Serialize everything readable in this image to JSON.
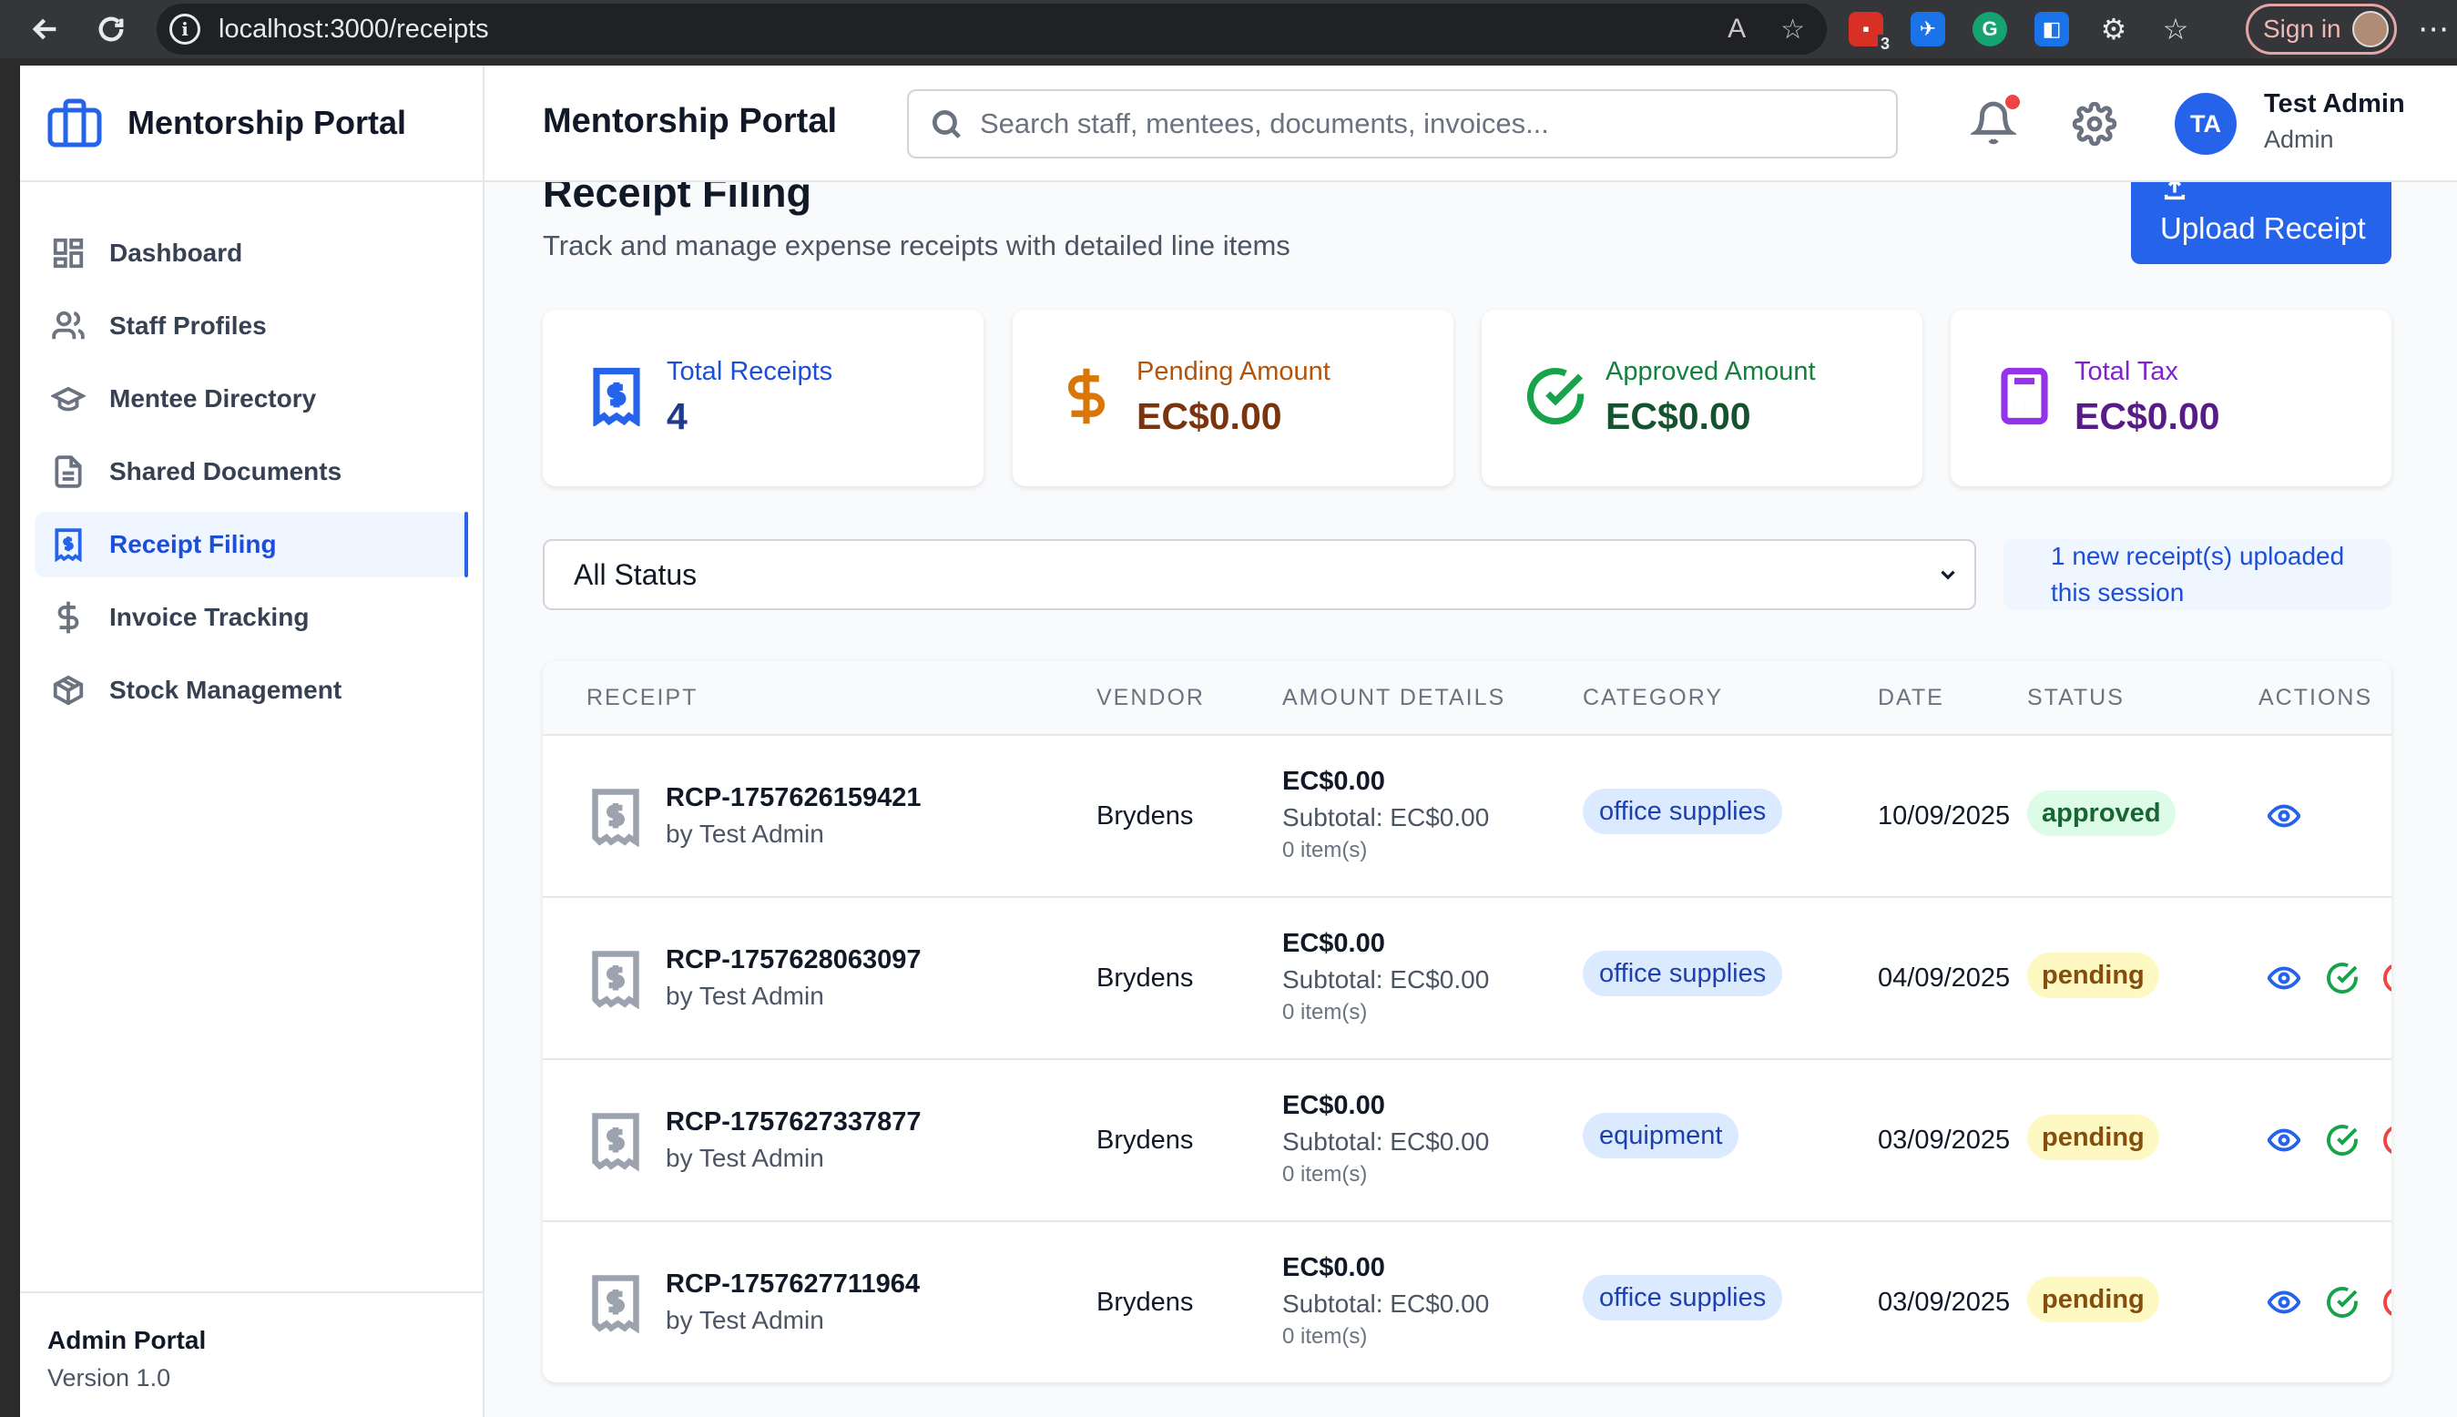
{
  "browser": {
    "url": "localhost:3000/receipts",
    "sign_in_label": "Sign in",
    "ext_badge_count": "3"
  },
  "sidebar": {
    "brand": "Mentorship Portal",
    "items": [
      {
        "label": "Dashboard",
        "icon": "grid-icon"
      },
      {
        "label": "Staff Profiles",
        "icon": "users-icon"
      },
      {
        "label": "Mentee Directory",
        "icon": "graduation-cap-icon"
      },
      {
        "label": "Shared Documents",
        "icon": "document-icon"
      },
      {
        "label": "Receipt Filing",
        "icon": "receipt-icon",
        "active": true
      },
      {
        "label": "Invoice Tracking",
        "icon": "dollar-icon"
      },
      {
        "label": "Stock Management",
        "icon": "package-icon"
      }
    ],
    "footer_title": "Admin Portal",
    "footer_version": "Version 1.0"
  },
  "header": {
    "title": "Mentorship Portal",
    "search_placeholder": "Search staff, mentees, documents, invoices...",
    "user_initials": "TA",
    "user_name": "Test Admin",
    "user_role": "Admin"
  },
  "page": {
    "title": "Receipt Filing",
    "subtitle": "Track and manage expense receipts with detailed line items",
    "upload_label": "Upload Receipt"
  },
  "stats": [
    {
      "label": "Total Receipts",
      "value": "4",
      "icon": "receipt-icon",
      "label_color": "#1d4ed8",
      "value_color": "#1e3a8a"
    },
    {
      "label": "Pending Amount",
      "value": "EC$0.00",
      "icon": "dollar-icon",
      "label_color": "#b45309",
      "value_color": "#78350f"
    },
    {
      "label": "Approved Amount",
      "value": "EC$0.00",
      "icon": "check-circle-icon",
      "label_color": "#15803d",
      "value_color": "#14532d"
    },
    {
      "label": "Total Tax",
      "value": "EC$0.00",
      "icon": "calculator-icon",
      "label_color": "#7e22ce",
      "value_color": "#581c87"
    }
  ],
  "filter": {
    "selected": "All Status",
    "note_line1": "1 new receipt(s) uploaded",
    "note_line2": "this session"
  },
  "table": {
    "columns": [
      "RECEIPT",
      "VENDOR",
      "AMOUNT DETAILS",
      "CATEGORY",
      "DATE",
      "STATUS",
      "ACTIONS"
    ],
    "rows": [
      {
        "id": "RCP-1757626159421",
        "by": "by Test Admin",
        "vendor": "Brydens",
        "amount": "EC$0.00",
        "subtotal": "Subtotal: EC$0.00",
        "items": "0 item(s)",
        "category": "office supplies",
        "date": "10/09/2025",
        "status": "approved"
      },
      {
        "id": "RCP-1757628063097",
        "by": "by Test Admin",
        "vendor": "Brydens",
        "amount": "EC$0.00",
        "subtotal": "Subtotal: EC$0.00",
        "items": "0 item(s)",
        "category": "office supplies",
        "date": "04/09/2025",
        "status": "pending"
      },
      {
        "id": "RCP-1757627337877",
        "by": "by Test Admin",
        "vendor": "Brydens",
        "amount": "EC$0.00",
        "subtotal": "Subtotal: EC$0.00",
        "items": "0 item(s)",
        "category": "equipment",
        "date": "03/09/2025",
        "status": "pending"
      },
      {
        "id": "RCP-1757627711964",
        "by": "by Test Admin",
        "vendor": "Brydens",
        "amount": "EC$0.00",
        "subtotal": "Subtotal: EC$0.00",
        "items": "0 item(s)",
        "category": "office supplies",
        "date": "03/09/2025",
        "status": "pending"
      }
    ]
  },
  "colors": {
    "accent": "#2563eb",
    "approved_bg": "#dcfce7",
    "pending_bg": "#fef9c3"
  }
}
